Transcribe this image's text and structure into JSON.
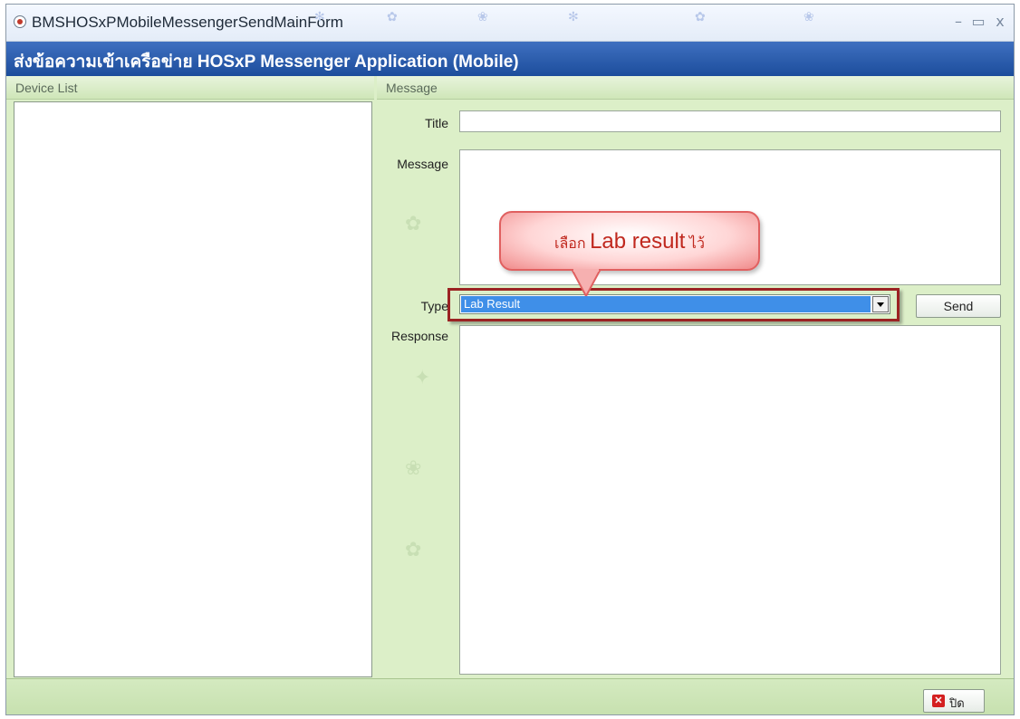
{
  "window": {
    "title": "BMSHOSxPMobileMessengerSendMainForm"
  },
  "banner": {
    "text": "ส่งข้อความเข้าเครือข่าย HOSxP Messenger Application (Mobile)"
  },
  "panels": {
    "device_list_header": "Device List",
    "message_header": "Message"
  },
  "form": {
    "title_label": "Title",
    "title_value": "",
    "message_label": "Message",
    "message_value": "",
    "type_label": "Type",
    "type_selected": "Lab Result",
    "send_button": "Send",
    "response_label": "Response",
    "response_value": ""
  },
  "callout": {
    "prefix": "เลือก",
    "emphasis": "Lab result",
    "suffix": "ไว้"
  },
  "footer": {
    "close_button": "ปิด"
  },
  "colors": {
    "banner": "#1c4d9c",
    "panel_bg": "#dcefc8",
    "selection": "#3f8fe8",
    "highlight_border": "#9b2323",
    "callout_text": "#c0281e"
  },
  "icons": [
    "app-icon",
    "minimize-icon",
    "restore-icon",
    "close-icon",
    "dropdown-arrow-icon",
    "close-x-icon"
  ]
}
